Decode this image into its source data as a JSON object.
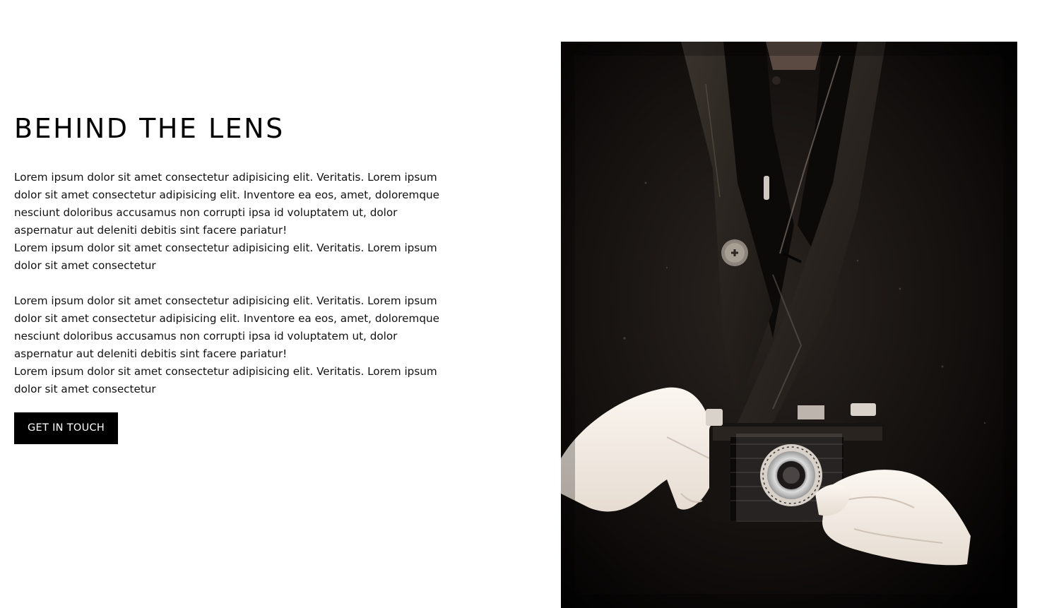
{
  "section": {
    "title": "BEHIND THE LENS",
    "paragraphs": [
      "Lorem ipsum dolor sit amet consectetur adipisicing elit. Veritatis. Lorem ipsum dolor sit amet consectetur adipisicing elit. Inventore ea eos, amet, doloremque nesciunt doloribus accusamus non corrupti ipsa id voluptatem ut, dolor aspernatur aut deleniti debitis sint facere pariatur!\nLorem ipsum dolor sit amet consectetur adipisicing elit. Veritatis. Lorem ipsum dolor sit amet consectetur",
      "Lorem ipsum dolor sit amet consectetur adipisicing elit. Veritatis. Lorem ipsum dolor sit amet consectetur adipisicing elit. Inventore ea eos, amet, doloremque nesciunt doloribus accusamus non corrupti ipsa id voluptatem ut, dolor aspernatur aut deleniti debitis sint facere pariatur!\nLorem ipsum dolor sit amet consectetur adipisicing elit. Veritatis. Lorem ipsum dolor sit amet consectetur"
    ],
    "cta_label": "GET IN TOUCH"
  },
  "photo": {
    "subject": "person-in-dark-coat-holding-vintage-folding-camera"
  },
  "colors": {
    "text": "#111111",
    "button_bg": "#000000",
    "button_text": "#ffffff",
    "background": "#ffffff"
  }
}
